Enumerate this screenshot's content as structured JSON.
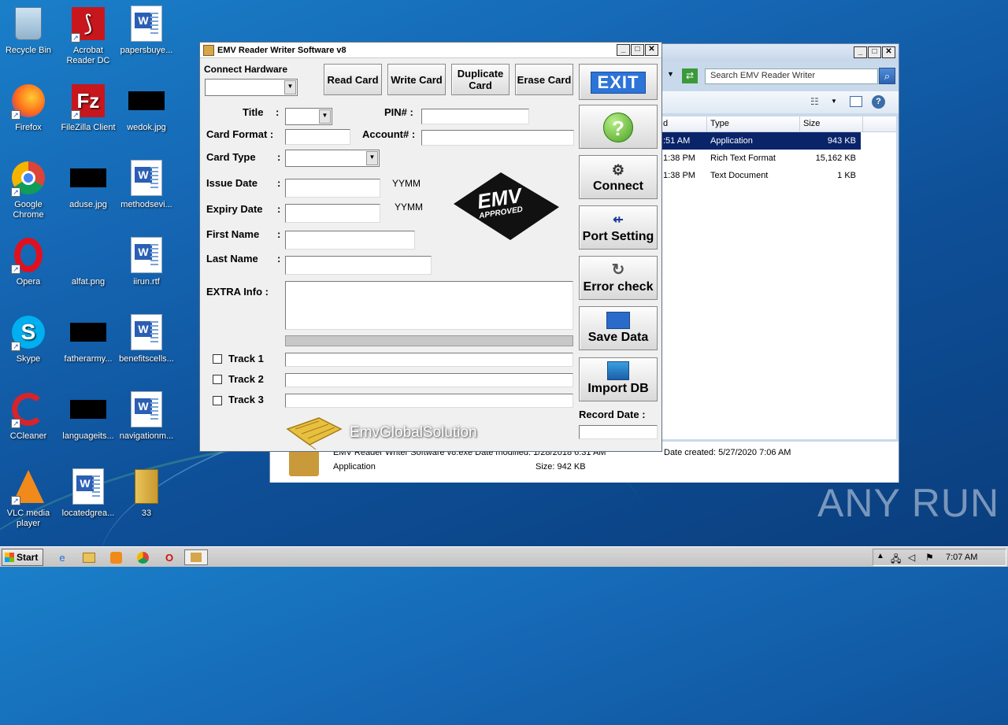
{
  "desktop": {
    "icons": [
      {
        "label": "Recycle Bin"
      },
      {
        "label": "Acrobat Reader DC"
      },
      {
        "label": "papersbuye..."
      },
      {
        "label": "Firefox"
      },
      {
        "label": "FileZilla Client"
      },
      {
        "label": "wedok.jpg"
      },
      {
        "label": "Google Chrome"
      },
      {
        "label": "aduse.jpg"
      },
      {
        "label": "methodsevi..."
      },
      {
        "label": "Opera"
      },
      {
        "label": "alfat.png"
      },
      {
        "label": "iirun.rtf"
      },
      {
        "label": "Skype"
      },
      {
        "label": "fatherarmy..."
      },
      {
        "label": "benefitscells..."
      },
      {
        "label": "CCleaner"
      },
      {
        "label": "languageits..."
      },
      {
        "label": "navigationm..."
      },
      {
        "label": "VLC media player"
      },
      {
        "label": "locatedgrea..."
      },
      {
        "label": "33"
      }
    ],
    "watermark": "ANY RUN"
  },
  "explorer": {
    "search_placeholder": "Search EMV Reader Writer",
    "columns": [
      "d",
      "Type",
      "Size"
    ],
    "rows": [
      {
        "date": ":51 AM",
        "type": "Application",
        "size": "943 KB"
      },
      {
        "date": "1:38 PM",
        "type": "Rich Text Format",
        "size": "15,162 KB"
      },
      {
        "date": "1:38 PM",
        "type": "Text Document",
        "size": "1 KB"
      }
    ],
    "details": {
      "name_line": "EMV Reader Writer  Software v8.exe  Date modified: 1/28/2018 6:31 AM",
      "date_created": "Date created: 5/27/2020 7:06 AM",
      "type": "Application",
      "size": "Size: 942 KB"
    }
  },
  "emv": {
    "title": "EMV Reader Writer Software v8",
    "connect_hardware": "Connect Hardware",
    "buttons": {
      "read": "Read Card",
      "write": "Write Card",
      "duplicate": "Duplicate Card",
      "erase": "Erase Card"
    },
    "labels": {
      "title": "Title",
      "pin": "PIN# :",
      "card_format": "Card Format :",
      "account": "Account# :",
      "card_type": "Card Type",
      "issue_date": "Issue Date",
      "expiry_date": "Expiry Date",
      "first_name": "First Name",
      "last_name": "Last Name",
      "extra_info": "EXTRA Info :",
      "colon": ":",
      "yymm": "YYMM",
      "track1": "Track 1",
      "track2": "Track 2",
      "track3": "Track 3",
      "record_date": "Record Date :",
      "brand": "EmvGlobalSolution"
    },
    "logo": {
      "top": "EMV",
      "bottom": "APPROVED"
    },
    "side_buttons": {
      "exit": "EXIT",
      "help": "?",
      "connect": "Connect",
      "port": "Port Setting",
      "error": "Error check",
      "save": "Save Data",
      "import": "Import DB"
    }
  },
  "taskbar": {
    "start": "Start",
    "time": "7:07 AM"
  }
}
